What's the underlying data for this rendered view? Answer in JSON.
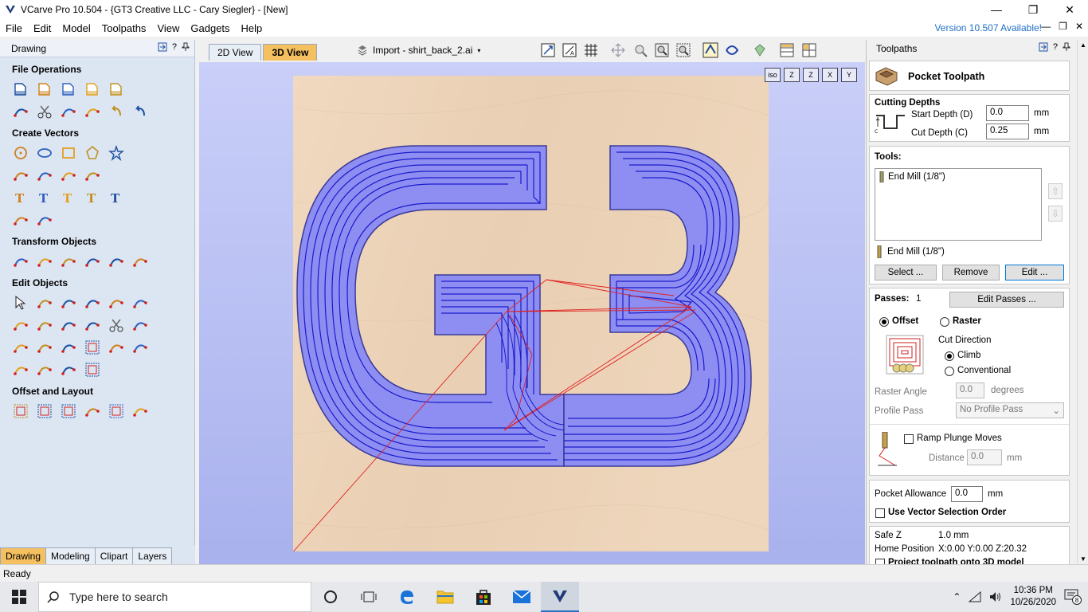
{
  "window": {
    "title": "VCarve Pro 10.504 - {GT3 Creative LLC - Cary Siegler} - [New]",
    "minimize": "—",
    "maximize": "❐",
    "close": "✕"
  },
  "menu": {
    "items": [
      "File",
      "Edit",
      "Model",
      "Toolpaths",
      "View",
      "Gadgets",
      "Help"
    ],
    "version_notice": "Version 10.507 Available!",
    "mdi_buttons": [
      "—",
      "❐",
      "✕"
    ]
  },
  "left_panel": {
    "title": "Drawing",
    "header_icons": [
      "pin-icon",
      "help-icon",
      "pushpin-icon"
    ],
    "help_glyph": "?",
    "sections": [
      {
        "title": "File Operations",
        "rows": [
          [
            "new-file-icon",
            "open-file-icon",
            "save-file-icon",
            "open-folder-icon",
            "import-icon"
          ],
          [
            "fit-view-icon",
            "cut-icon",
            "copy-icon",
            "paste-icon",
            "undo-icon",
            "redo-icon"
          ]
        ]
      },
      {
        "title": "Create Vectors",
        "rows": [
          [
            "circle-icon",
            "ellipse-icon",
            "rectangle-icon",
            "polygon-icon",
            "star-icon"
          ],
          [
            "polyline-icon",
            "arc-icon",
            "curve-icon",
            "spiral-icon"
          ],
          [
            "text-icon",
            "text-frame-icon",
            "text-on-curve-icon",
            "auto-layout-text-icon",
            "text-arc-icon"
          ],
          [
            "dimension-icon",
            "measure-icon"
          ]
        ]
      },
      {
        "title": "Transform Objects",
        "rows": [
          [
            "move-icon",
            "scale-icon",
            "align-icon",
            "mirror-icon",
            "distort-icon",
            "center-icon"
          ]
        ]
      },
      {
        "title": "Edit Objects",
        "rows": [
          [
            "select-icon",
            "node-edit-icon",
            "node-add-icon",
            "interactive-trim-icon",
            "weld-icon",
            "measure-tool-icon"
          ],
          [
            "subtract-icon",
            "intersect-icon",
            "ungroup-icon",
            "fillet-icon",
            "scissors-icon",
            "smooth-icon"
          ],
          [
            "join-icon",
            "close-vector-icon",
            "extend-icon",
            "offset-curve-icon",
            "create-fillet-icon",
            "image-trace-icon"
          ],
          [
            "group-icon",
            "trim-icon",
            "curve-fit-icon",
            "nest-icon"
          ]
        ]
      },
      {
        "title": "Offset and Layout",
        "rows": [
          [
            "offset-icon",
            "array-copy-icon",
            "circular-array-icon",
            "step-repeat-icon",
            "nesting-icon",
            "rotate-copy-icon"
          ]
        ]
      }
    ],
    "tabs": [
      "Drawing",
      "Modeling",
      "Clipart",
      "Layers"
    ],
    "active_tab": "Drawing"
  },
  "view": {
    "tabs": [
      "2D View",
      "3D View"
    ],
    "active_tab": "3D View",
    "import_label": "Import - shirt_back_2.ai",
    "axes": [
      "iso",
      "Z",
      "Z",
      "X",
      "Y"
    ],
    "wood_color": "#ecd3b8",
    "pocket_color": "#8e8ef2",
    "toolpath_color": "#1a1acc",
    "rapid_color": "#e02020"
  },
  "right_panel": {
    "title": "Toolpaths",
    "heading": "Pocket Toolpath",
    "cutting_depths": {
      "title": "Cutting Depths",
      "start_label": "Start Depth (D)",
      "start_value": "0.0",
      "start_unit": "mm",
      "cut_label": "Cut Depth (C)",
      "cut_value": "0.25",
      "cut_unit": "mm"
    },
    "tools": {
      "title": "Tools:",
      "list": [
        "End Mill (1/8\")"
      ],
      "selected": "End Mill (1/8\")",
      "select_btn": "Select ...",
      "remove_btn": "Remove",
      "edit_btn": "Edit ..."
    },
    "passes": {
      "label": "Passes:",
      "value": "1",
      "edit_btn": "Edit Passes ..."
    },
    "strategy": {
      "offset_label": "Offset",
      "raster_label": "Raster",
      "selected": "Offset",
      "cut_direction_label": "Cut Direction",
      "climb_label": "Climb",
      "conventional_label": "Conventional",
      "direction_selected": "Climb",
      "raster_angle_label": "Raster Angle",
      "raster_angle_value": "0.0",
      "raster_angle_unit": "degrees",
      "profile_pass_label": "Profile Pass",
      "profile_pass_value": "No Profile Pass"
    },
    "ramp": {
      "label": "Ramp Plunge Moves",
      "checked": false,
      "distance_label": "Distance",
      "distance_value": "0.0",
      "distance_unit": "mm"
    },
    "allowance": {
      "label": "Pocket Allowance",
      "value": "0.0",
      "unit": "mm",
      "vector_order_label": "Use Vector Selection Order",
      "vector_order_checked": false
    },
    "summary": {
      "safe_z_label": "Safe Z",
      "safe_z_value": "1.0 mm",
      "home_label": "Home Position",
      "home_value": "X:0.00 Y:0.00 Z:20.32",
      "project_label": "Project toolpath onto 3D model"
    }
  },
  "status": {
    "text": "Ready"
  },
  "taskbar": {
    "search_placeholder": "Type here to search",
    "apps": [
      "cortana-icon",
      "task-view-icon",
      "edge-icon",
      "file-explorer-icon",
      "store-icon",
      "mail-icon",
      "vcarve-icon"
    ],
    "time": "10:36 PM",
    "date": "10/26/2020",
    "notification_count": "8"
  }
}
